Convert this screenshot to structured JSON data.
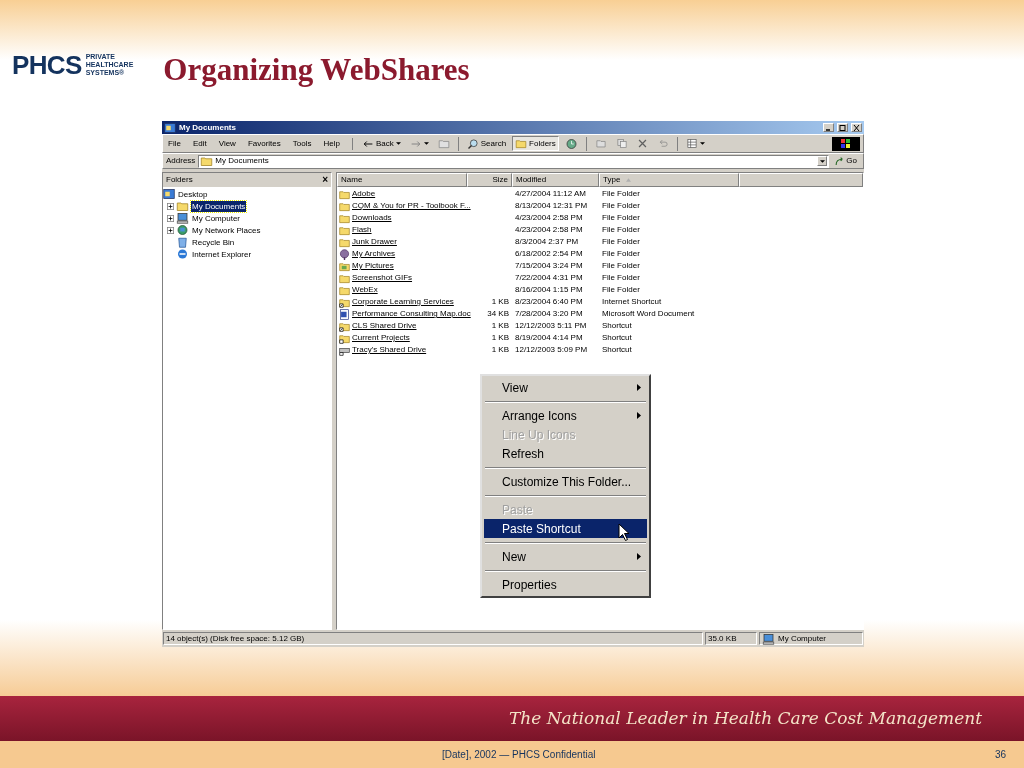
{
  "slide": {
    "logo": {
      "mark": "PHCS",
      "tagline": [
        "PRIVATE",
        "HEALTHCARE",
        "SYSTEMS®"
      ]
    },
    "title": "Organizing WebShares",
    "slogan": "The National Leader in Health Care Cost Management",
    "footer": "[Date], 2002 — PHCS Confidential",
    "page_number": "36"
  },
  "window": {
    "title": "My Documents",
    "menu": [
      "File",
      "Edit",
      "View",
      "Favorites",
      "Tools",
      "Help"
    ],
    "toolbar": [
      {
        "kind": "back",
        "label": "Back",
        "selected": false
      },
      {
        "kind": "forward",
        "selected": false
      },
      {
        "kind": "up",
        "selected": false
      },
      {
        "kind": "search",
        "label": "Search",
        "selected": false
      },
      {
        "kind": "folders",
        "label": "Folders",
        "selected": true
      },
      {
        "kind": "history",
        "selected": false
      },
      {
        "kind": "move",
        "selected": false
      },
      {
        "kind": "copy",
        "selected": false
      },
      {
        "kind": "delete",
        "selected": false
      },
      {
        "kind": "undo",
        "selected": false
      },
      {
        "kind": "views",
        "selected": false
      }
    ],
    "address": {
      "label": "Address",
      "value": "My Documents",
      "go": "Go"
    },
    "folders_pane": {
      "title": "Folders",
      "close": "×",
      "tree": [
        {
          "label": "Desktop",
          "kind": "desktop",
          "expandable": false,
          "selected": false,
          "children": [
            {
              "label": "My Documents",
              "kind": "documents",
              "expandable": true,
              "selected": true
            },
            {
              "label": "My Computer",
              "kind": "computer",
              "expandable": true,
              "selected": false
            },
            {
              "label": "My Network Places",
              "kind": "network",
              "expandable": true,
              "selected": false
            },
            {
              "label": "Recycle Bin",
              "kind": "recycle",
              "expandable": false,
              "selected": false
            },
            {
              "label": "Internet Explorer",
              "kind": "ie",
              "expandable": false,
              "selected": false
            }
          ]
        }
      ]
    },
    "file_list": {
      "columns": [
        {
          "label": "Name",
          "sorted": false
        },
        {
          "label": "Size",
          "sorted": false
        },
        {
          "label": "Modified",
          "sorted": false
        },
        {
          "label": "Type",
          "sorted": true
        }
      ],
      "rows": [
        {
          "kind": "folder",
          "name": "Adobe",
          "modified": "4/27/2004 11:12 AM",
          "type": "File Folder"
        },
        {
          "kind": "folder",
          "name": "CQM & You for PR - Toolbook F...",
          "modified": "8/13/2004 12:31 PM",
          "type": "File Folder"
        },
        {
          "kind": "folder",
          "name": "Downloads",
          "modified": "4/23/2004 2:58 PM",
          "type": "File Folder"
        },
        {
          "kind": "folder",
          "name": "Flash",
          "modified": "4/23/2004 2:58 PM",
          "type": "File Folder"
        },
        {
          "kind": "folder",
          "name": "Junk Drawer",
          "modified": "8/3/2004 2:37 PM",
          "type": "File Folder"
        },
        {
          "kind": "archive",
          "name": "My Archives",
          "modified": "6/18/2002 2:54 PM",
          "type": "File Folder"
        },
        {
          "kind": "pictures",
          "name": "My Pictures",
          "modified": "7/15/2004 3:24 PM",
          "type": "File Folder"
        },
        {
          "kind": "folder",
          "name": "Screenshot GIFs",
          "modified": "7/22/2004 4:31 PM",
          "type": "File Folder"
        },
        {
          "kind": "folder",
          "name": "WebEx",
          "modified": "8/16/2004 1:15 PM",
          "type": "File Folder"
        },
        {
          "kind": "web_shortcut",
          "name": "Corporate Learning Services",
          "size": "1 KB",
          "modified": "8/23/2004 6:40 PM",
          "type": "Internet Shortcut"
        },
        {
          "kind": "word",
          "name": "Performance Consulting Map.doc",
          "size": "34 KB",
          "modified": "7/28/2004 3:20 PM",
          "type": "Microsoft Word Document"
        },
        {
          "kind": "web_shortcut",
          "name": "CLS Shared Drive",
          "size": "1 KB",
          "modified": "12/12/2003 5:11 PM",
          "type": "Shortcut"
        },
        {
          "kind": "folder_shortcut",
          "name": "Current Projects",
          "size": "1 KB",
          "modified": "8/19/2004 4:14 PM",
          "type": "Shortcut"
        },
        {
          "kind": "drive_shortcut",
          "name": "Tracy's Shared Drive",
          "size": "1 KB",
          "modified": "12/12/2003 5:09 PM",
          "type": "Shortcut"
        }
      ]
    },
    "context_menu": [
      {
        "kind": "item",
        "label": "View",
        "disabled": false,
        "selected": false,
        "submenu": true
      },
      {
        "kind": "separator"
      },
      {
        "kind": "item",
        "label": "Arrange Icons",
        "disabled": false,
        "selected": false,
        "submenu": true
      },
      {
        "kind": "item",
        "label": "Line Up Icons",
        "disabled": true,
        "selected": false,
        "submenu": false
      },
      {
        "kind": "item",
        "label": "Refresh",
        "disabled": false,
        "selected": false,
        "submenu": false
      },
      {
        "kind": "separator"
      },
      {
        "kind": "item",
        "label": "Customize This Folder...",
        "disabled": false,
        "selected": false,
        "submenu": false
      },
      {
        "kind": "separator"
      },
      {
        "kind": "item",
        "label": "Paste",
        "disabled": true,
        "selected": false,
        "submenu": false
      },
      {
        "kind": "item",
        "label": "Paste Shortcut",
        "disabled": false,
        "selected": true,
        "submenu": false
      },
      {
        "kind": "separator"
      },
      {
        "kind": "item",
        "label": "New",
        "disabled": false,
        "selected": false,
        "submenu": true
      },
      {
        "kind": "separator"
      },
      {
        "kind": "item",
        "label": "Properties",
        "disabled": false,
        "selected": false,
        "submenu": false
      }
    ],
    "status_bar": [
      {
        "kind": "text",
        "text": "14 object(s) (Disk free space: 5.12 GB)"
      },
      {
        "kind": "text",
        "text": "35.0 KB"
      },
      {
        "kind": "zone",
        "text": "My Computer"
      }
    ]
  }
}
